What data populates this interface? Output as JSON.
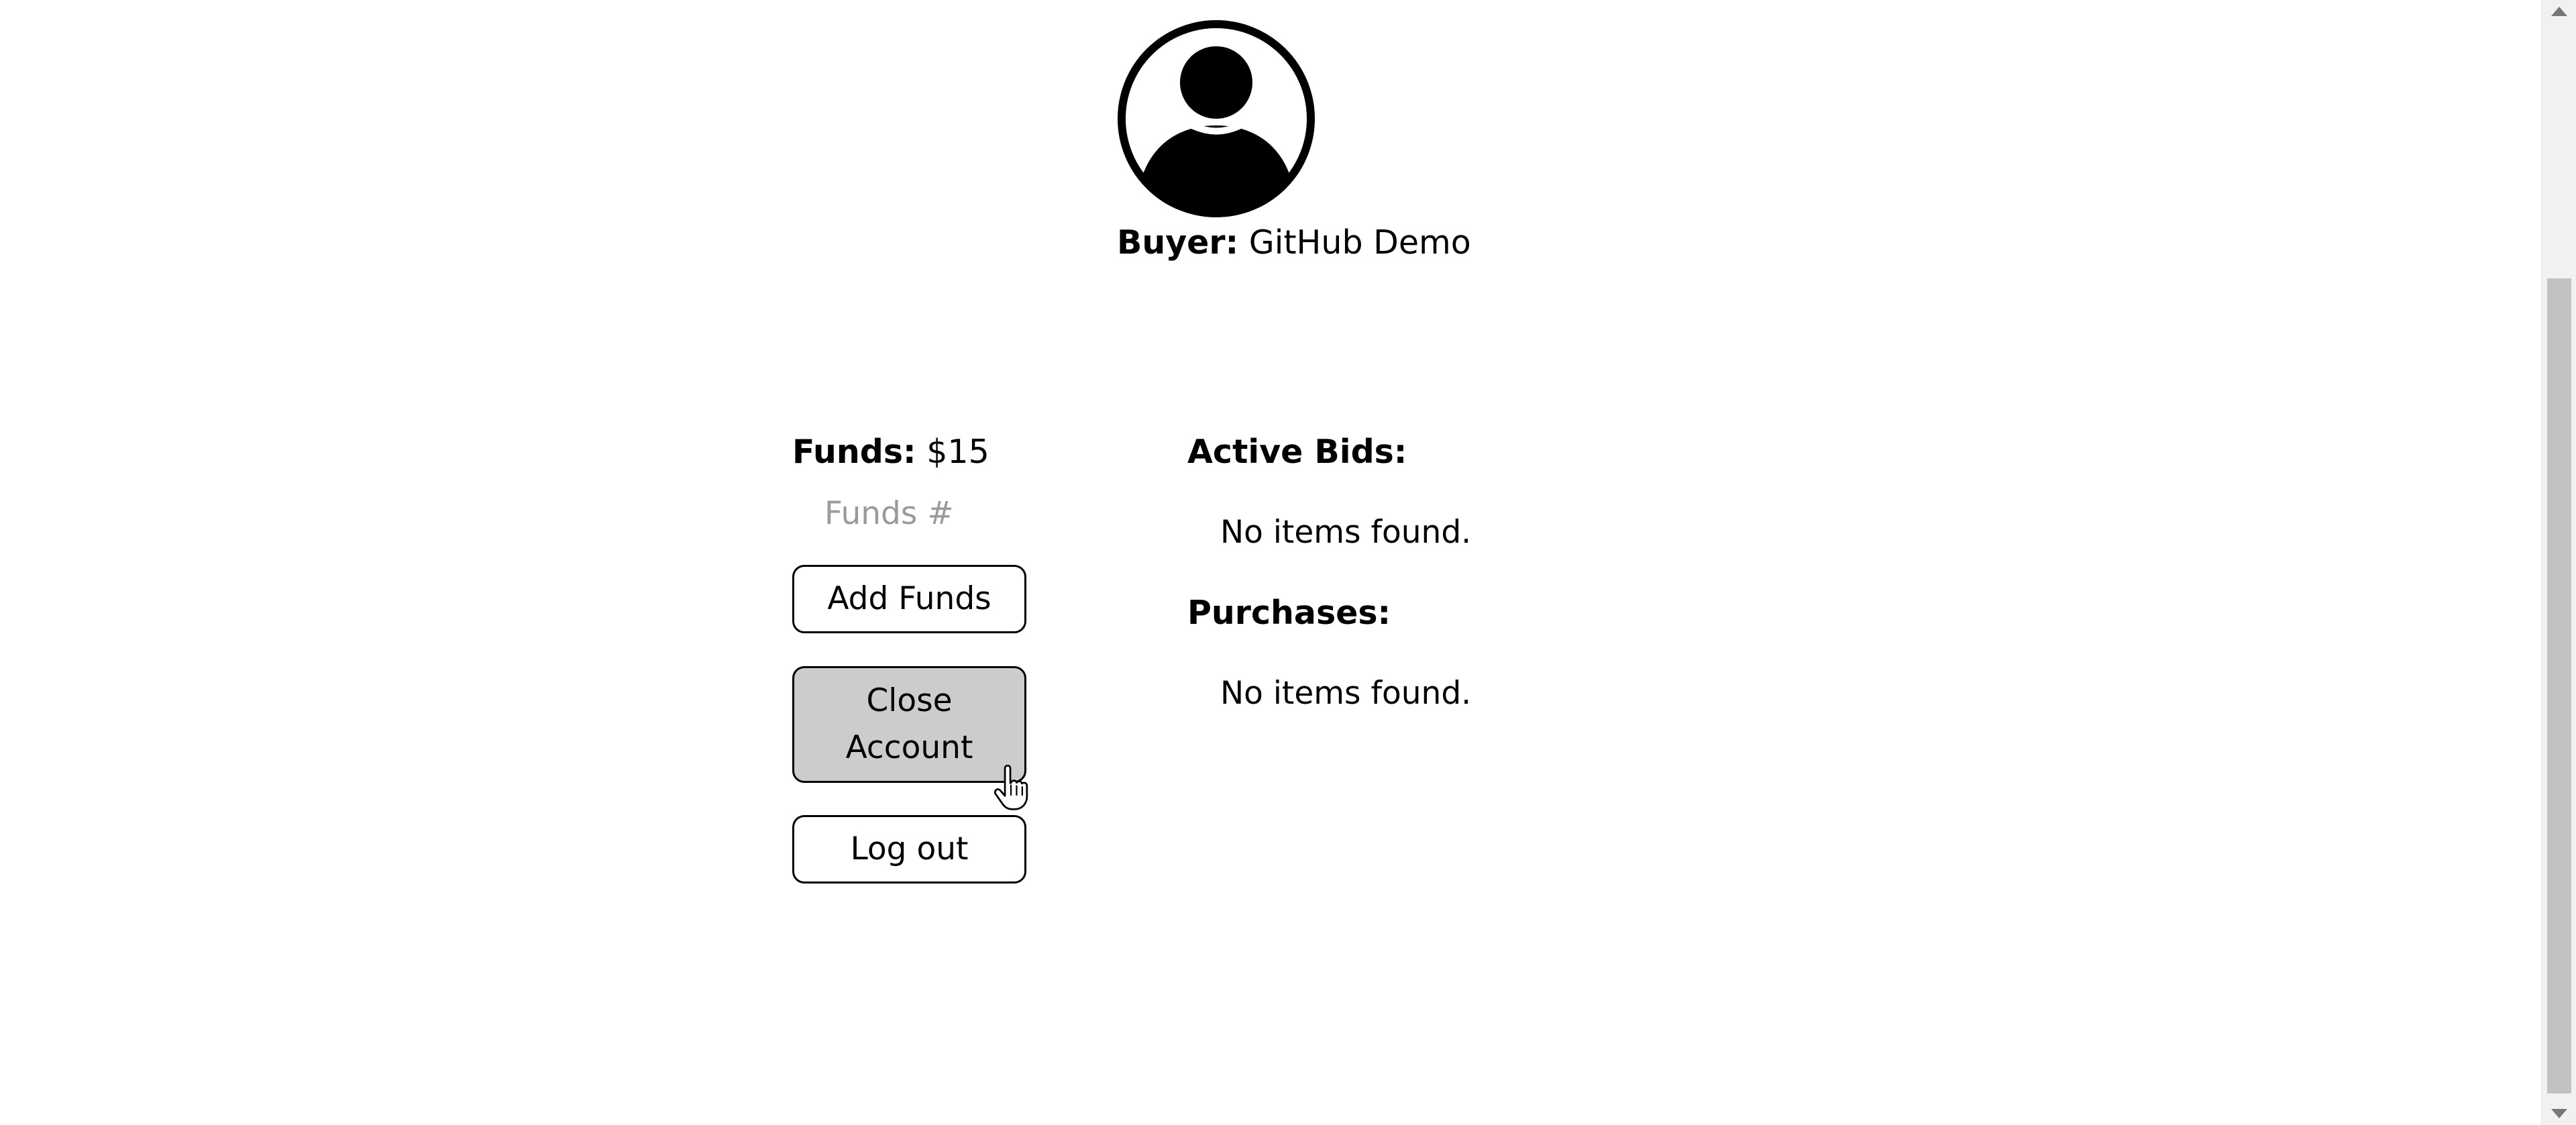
{
  "profile": {
    "avatar_icon": "user-avatar-icon",
    "buyer_label": "Buyer:",
    "buyer_name": "GitHub Demo"
  },
  "funds": {
    "label": "Funds:",
    "amount": "$15",
    "input_placeholder": "Funds #",
    "input_value": ""
  },
  "actions": {
    "add_funds": "Add Funds",
    "close_account": "Close Account",
    "log_out": "Log out"
  },
  "active_bids": {
    "title": "Active Bids:",
    "empty_text": "No items found."
  },
  "purchases": {
    "title": "Purchases:",
    "empty_text": "No items found."
  },
  "cursor": {
    "icon": "hand-pointer-icon"
  },
  "colors": {
    "close_button_bg": "#cccccc",
    "placeholder": "#9a9a9a",
    "scroll_thumb": "#c1c1c1"
  }
}
